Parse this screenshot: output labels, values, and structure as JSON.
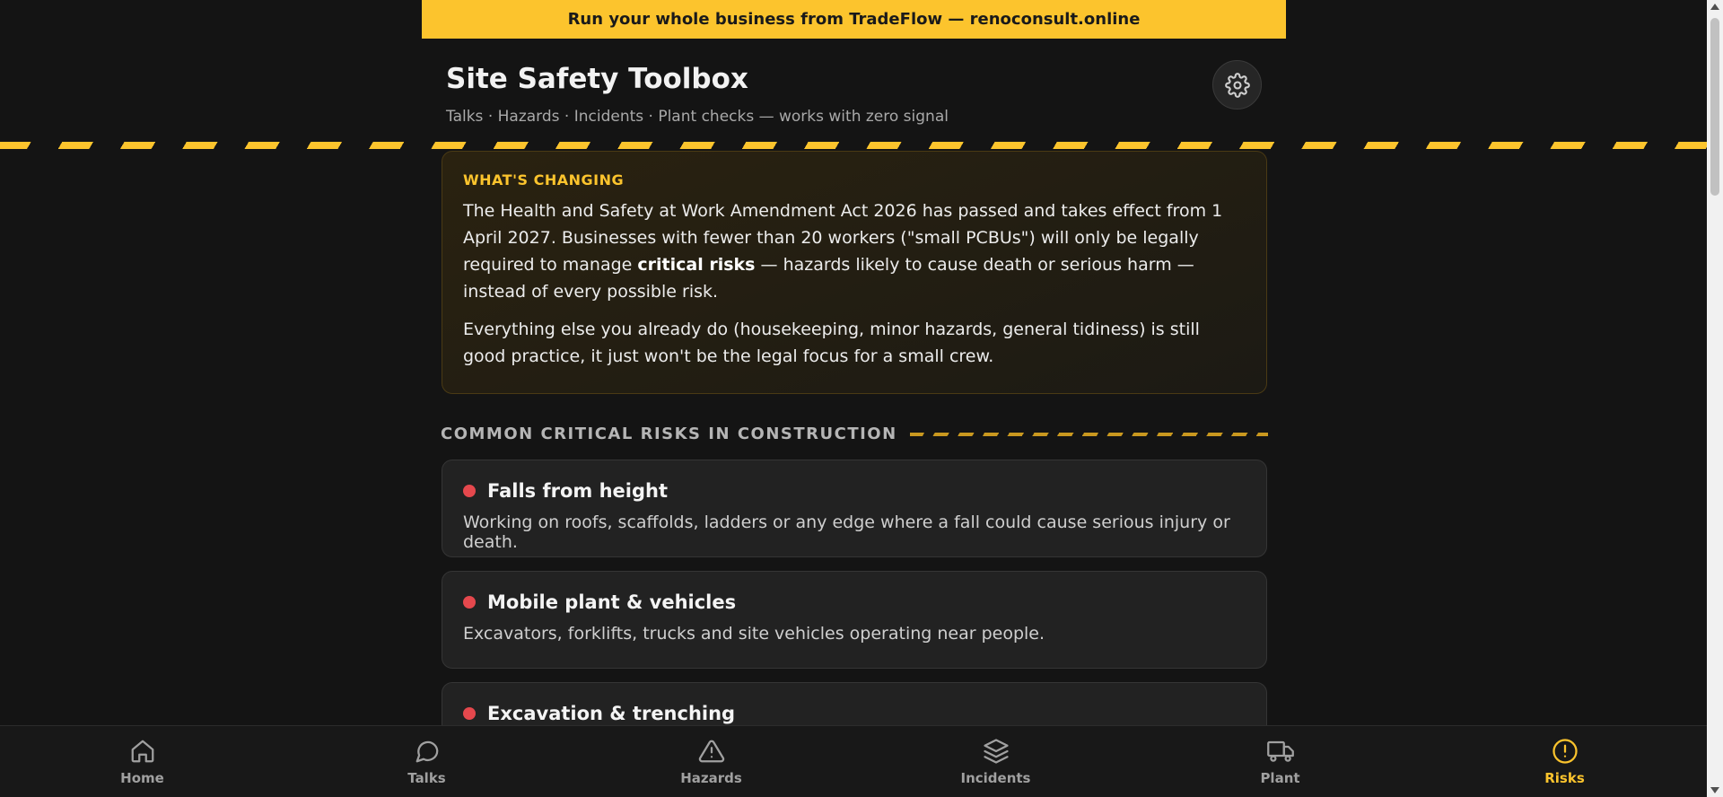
{
  "promo": {
    "text": "Run your whole business from TradeFlow — renoconsult.online"
  },
  "header": {
    "title": "Site Safety Toolbox",
    "subtitle": "Talks · Hazards · Incidents · Plant checks — works with zero signal",
    "settings_icon": "gear-icon"
  },
  "notice": {
    "label": "WHAT'S CHANGING",
    "p1_before": "The Health and Safety at Work Amendment Act 2026 has passed and takes effect from 1 April 2027. Businesses with fewer than 20 workers (\"small PCBUs\") will only be legally required to manage ",
    "p1_bold": "critical risks",
    "p1_after": " — hazards likely to cause death or serious harm — instead of every possible risk.",
    "p2": "Everything else you already do (housekeeping, minor hazards, general tidiness) is still good practice, it just won't be the legal focus for a small crew."
  },
  "section": {
    "title": "COMMON CRITICAL RISKS IN CONSTRUCTION"
  },
  "risks": [
    {
      "title": "Falls from height",
      "desc": "Working on roofs, scaffolds, ladders or any edge where a fall could cause serious injury or death."
    },
    {
      "title": "Mobile plant & vehicles",
      "desc": "Excavators, forklifts, trucks and site vehicles operating near people."
    },
    {
      "title": "Excavation & trenching",
      "desc": ""
    }
  ],
  "nav": [
    {
      "label": "Home",
      "icon": "home-icon"
    },
    {
      "label": "Talks",
      "icon": "chat-icon"
    },
    {
      "label": "Hazards",
      "icon": "warning-triangle-icon"
    },
    {
      "label": "Incidents",
      "icon": "layers-icon"
    },
    {
      "label": "Plant",
      "icon": "truck-icon"
    },
    {
      "label": "Risks",
      "icon": "alert-circle-icon",
      "active": true
    }
  ],
  "colors": {
    "accent": "#fcc42d",
    "background": "#141414",
    "risk_dot": "#e5484d"
  }
}
